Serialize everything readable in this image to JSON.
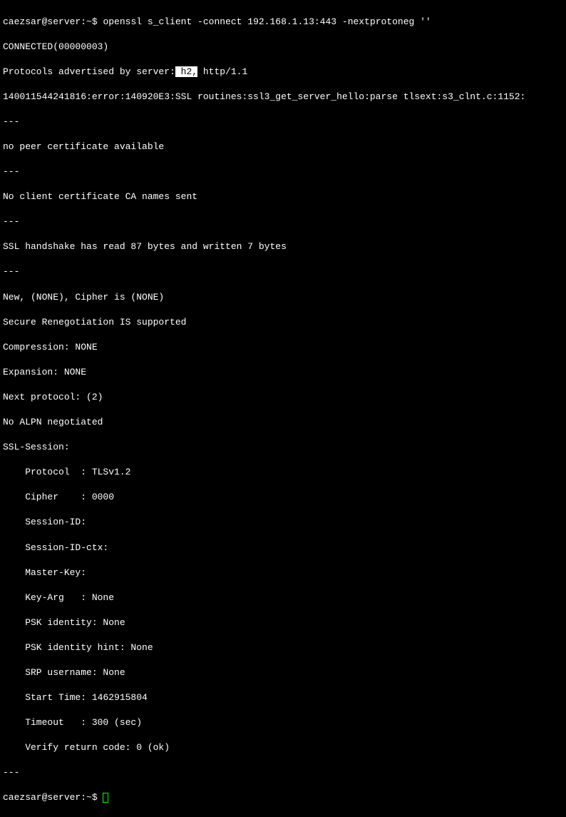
{
  "prompt1": {
    "user_host": "caezsar@server",
    "path": ":~$ ",
    "command": "openssl s_client -connect 192.168.1.13:443 -nextprotoneg ''"
  },
  "output": {
    "l1": "CONNECTED(00000003)",
    "l2a": "Protocols advertised by server:",
    "l2_highlight": " h2,",
    "l2b": " http/1.1",
    "l3": "140011544241816:error:140920E3:SSL routines:ssl3_get_server_hello:parse tlsext:s3_clnt.c:1152:",
    "l4": "---",
    "l5": "no peer certificate available",
    "l6": "---",
    "l7": "No client certificate CA names sent",
    "l8": "---",
    "l9": "SSL handshake has read 87 bytes and written 7 bytes",
    "l10": "---",
    "l11": "New, (NONE), Cipher is (NONE)",
    "l12": "Secure Renegotiation IS supported",
    "l13": "Compression: NONE",
    "l14": "Expansion: NONE",
    "l15": "Next protocol: (2)",
    "l16": "No ALPN negotiated",
    "l17": "SSL-Session:",
    "l18": "    Protocol  : TLSv1.2",
    "l19": "    Cipher    : 0000",
    "l20": "    Session-ID:",
    "l21": "    Session-ID-ctx:",
    "l22": "    Master-Key:",
    "l23": "    Key-Arg   : None",
    "l24": "    PSK identity: None",
    "l25": "    PSK identity hint: None",
    "l26": "    SRP username: None",
    "l27": "    Start Time: 1462915804",
    "l28": "    Timeout   : 300 (sec)",
    "l29": "    Verify return code: 0 (ok)",
    "l30": "---"
  },
  "prompt2": {
    "user_host": "caezsar@server",
    "path": ":~$ "
  }
}
